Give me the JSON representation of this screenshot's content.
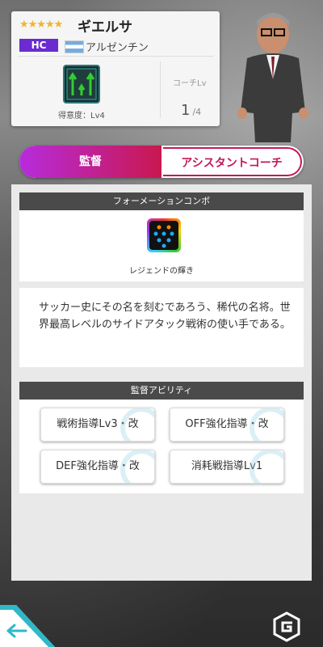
{
  "profile": {
    "stars": "★★★★★",
    "name": "ギエルサ",
    "role": "HC",
    "country": "アルゼンチン",
    "proficiency": "得意度：Lv4",
    "coach_lv_label": "コーチLv",
    "coach_lv": "1",
    "coach_lv_max": "/4"
  },
  "tabs": {
    "director": "監督",
    "assistant": "アシスタントコーチ"
  },
  "formation_combo": {
    "header": "フォーメーションコンボ",
    "label": "レジェンドの輝き"
  },
  "description": "サッカー史にその名を刻むであろう、稀代の名将。世界最高レベルのサイドアタック戦術の使い手である。",
  "abilities": {
    "header": "監督アビリティ",
    "items": [
      "戦術指導Lv3・改",
      "OFF強化指導・改",
      "DEF強化指導・改",
      "消耗戦指導Lv1"
    ]
  },
  "colors": {
    "accent": "#c2185b",
    "role_badge": "#6b2bd1"
  }
}
